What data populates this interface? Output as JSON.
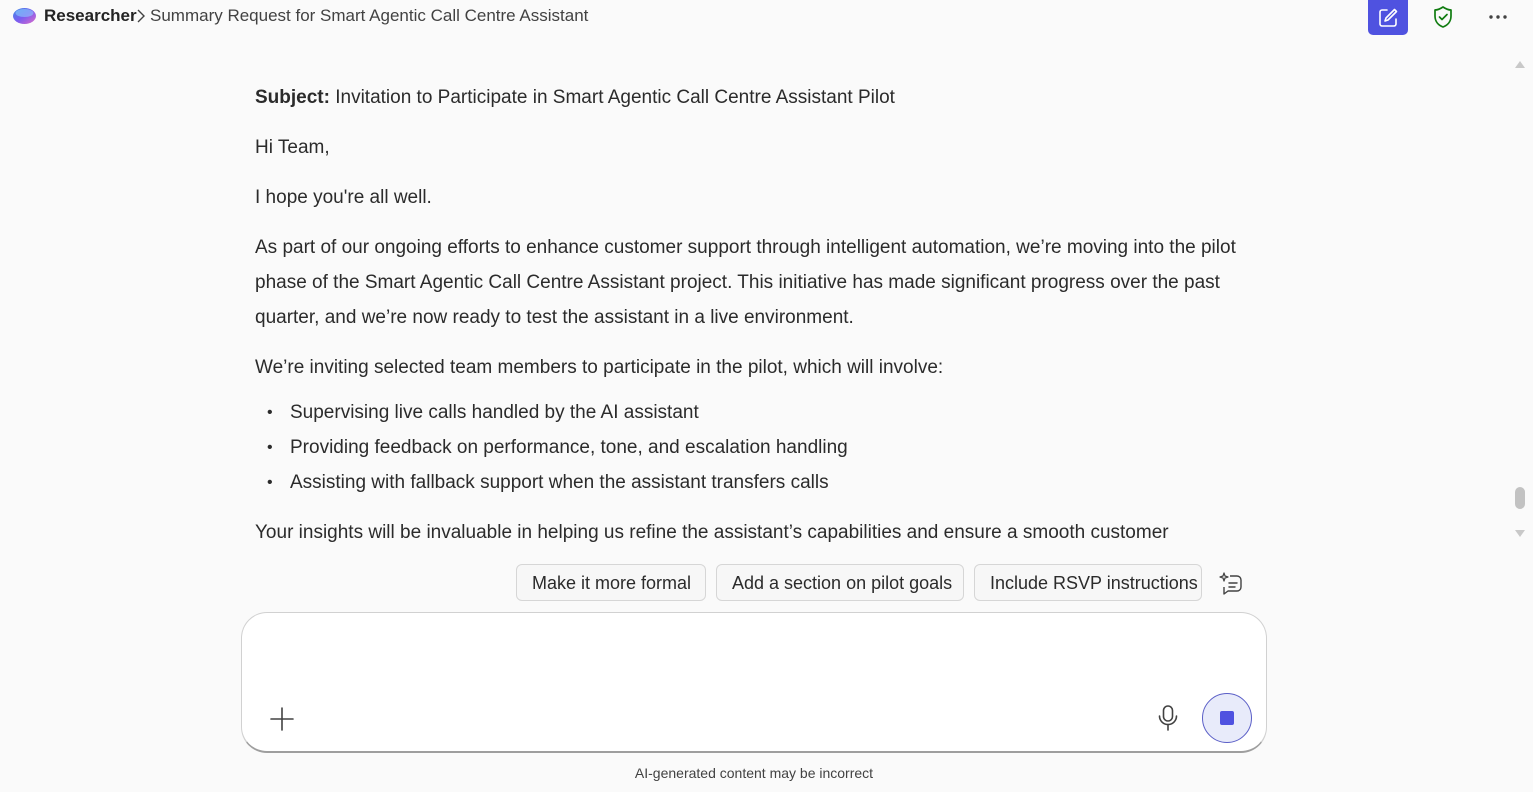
{
  "header": {
    "app_name": "Researcher",
    "conversation_title": "Summary Request for Smart Agentic Call Centre Assistant"
  },
  "message": {
    "subject_label": "Subject:",
    "subject_text": " Invitation to Participate in Smart Agentic Call Centre Assistant Pilot",
    "greeting": "Hi Team,",
    "opening": "I hope you're all well.",
    "paragraph1": "As part of our ongoing efforts to enhance customer support through intelligent automation, we’re moving into the pilot phase of the Smart Agentic Call Centre Assistant project. This initiative has made significant progress over the past quarter, and we’re now ready to test the assistant in a live environment.",
    "paragraph2": "We’re inviting selected team members to participate in the pilot, which will involve:",
    "bullets": [
      "Supervising live calls handled by the AI assistant",
      "Providing feedback on performance, tone, and escalation handling",
      "Assisting with fallback support when the assistant transfers calls"
    ],
    "paragraph3": "Your insights will be invaluable in helping us refine the assistant’s capabilities and ensure a smooth customer"
  },
  "suggestions": [
    "Make it more formal",
    "Add a section on pilot goals",
    "Include RSVP instructions"
  ],
  "composer": {
    "value": "",
    "placeholder": ""
  },
  "disclaimer": "AI-generated content may be incorrect",
  "icons": {
    "new_chat": "compose-icon",
    "shield": "shield-check-icon",
    "more": "more-horizontal-icon",
    "add": "plus-icon",
    "mic": "microphone-icon",
    "stop": "stop-icon",
    "suggestions_more": "sparkle-chat-icon"
  },
  "colors": {
    "accent": "#4f52e0",
    "shield": "#107c10",
    "background": "#fafafa"
  }
}
